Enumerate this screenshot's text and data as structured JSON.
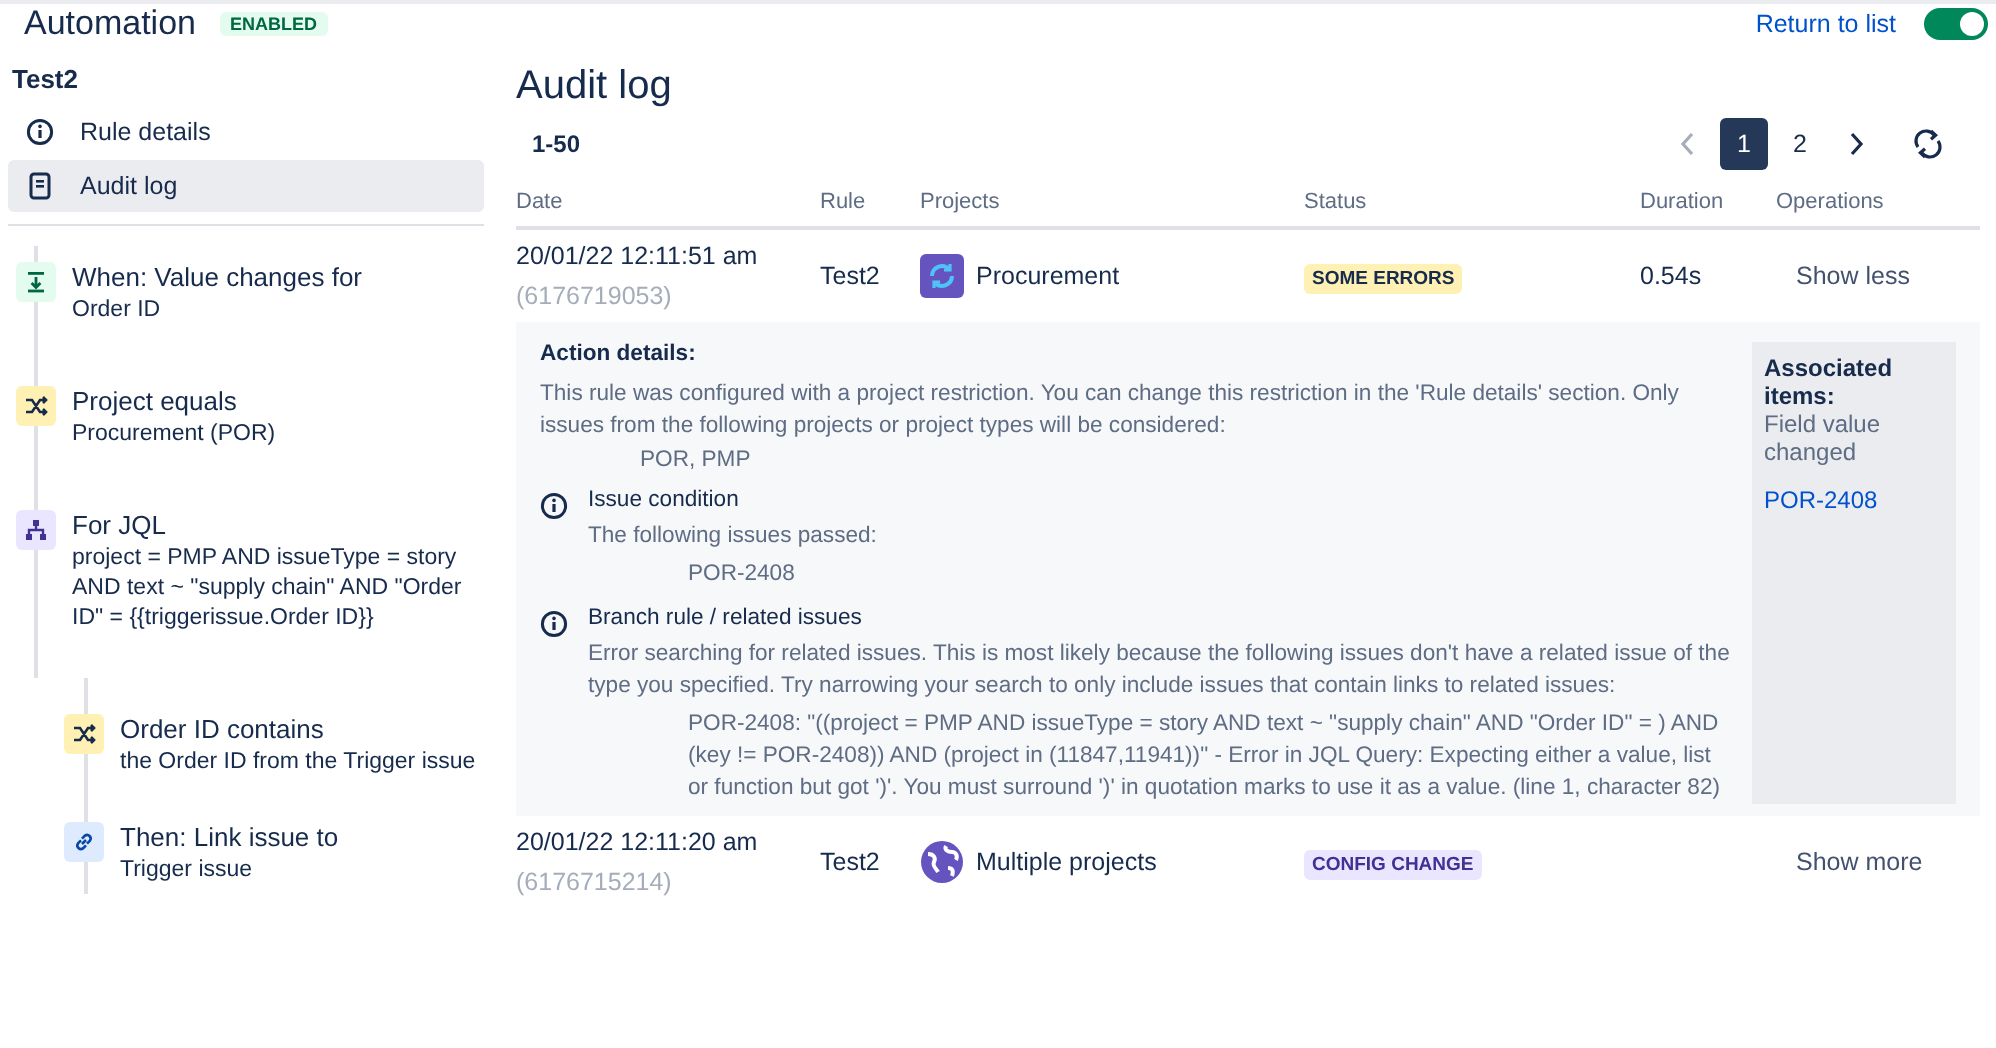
{
  "header": {
    "title": "Automation",
    "badge": "ENABLED",
    "return_link": "Return to list",
    "toggle": {
      "on": true
    }
  },
  "sidebar": {
    "rule_name": "Test2",
    "nav": [
      {
        "label": "Rule details",
        "selected": false
      },
      {
        "label": "Audit log",
        "selected": true
      }
    ],
    "steps": [
      {
        "kind": "trigger",
        "title": "When: Value changes for",
        "detail": "Order ID"
      },
      {
        "kind": "condition",
        "title": "Project equals",
        "detail": "Procurement (POR)"
      },
      {
        "kind": "branch",
        "title": "For JQL",
        "detail": "project = PMP AND issueType = story AND text ~ \"supply chain\" AND \"Order ID\" = {{triggerissue.Order ID}}",
        "children": [
          {
            "kind": "condition",
            "title": "Order ID contains",
            "detail": "the Order ID from the Trigger issue"
          },
          {
            "kind": "action",
            "title": "Then: Link issue to",
            "detail": "Trigger issue"
          }
        ]
      }
    ]
  },
  "audit": {
    "title": "Audit log",
    "range": "1-50",
    "pages": [
      {
        "label": "1",
        "selected": true
      },
      {
        "label": "2",
        "selected": false
      }
    ],
    "columns": [
      "Date",
      "Rule",
      "Projects",
      "Status",
      "Duration",
      "Operations"
    ],
    "rows": [
      {
        "date": "20/01/22 12:11:51 am",
        "id": "(6176719053)",
        "rule": "Test2",
        "project": {
          "name": "Procurement",
          "kind": "single"
        },
        "status": {
          "label": "SOME ERRORS",
          "kind": "warning"
        },
        "duration": "0.54s",
        "operation": "Show less",
        "details": {
          "heading": "Action details:",
          "text": "This rule was configured with a project restriction. You can change this restriction in the 'Rule details' section. Only issues from the following projects or project types will be considered:",
          "projects": "POR, PMP",
          "sections": [
            {
              "title": "Issue condition",
              "text": "The following issues passed:",
              "items": [
                "POR-2408"
              ]
            },
            {
              "title": "Branch rule / related issues",
              "text": "Error searching for related issues. This is most likely because the following issues don't have a related issue of the type you specified. Try narrowing your search to only include issues that contain links to related issues:",
              "items": [
                "POR-2408: \"((project = PMP AND issueType = story AND text ~ \"supply chain\" AND \"Order ID\" = ) AND (key != POR-2408)) AND (project in (11847,11941))\" - Error in JQL Query: Expecting either a value, list or function but got ')'. You must surround ')' in quotation marks to use it as a value. (line 1, character 82)"
              ]
            }
          ],
          "associated": {
            "title": "Associated items:",
            "text": "Field value changed",
            "link": "POR-2408"
          }
        }
      },
      {
        "date": "20/01/22 12:11:20 am",
        "id": "(6176715214)",
        "rule": "Test2",
        "project": {
          "name": "Multiple projects",
          "kind": "multiple"
        },
        "status": {
          "label": "CONFIG CHANGE",
          "kind": "config"
        },
        "operation": "Show more"
      }
    ]
  }
}
